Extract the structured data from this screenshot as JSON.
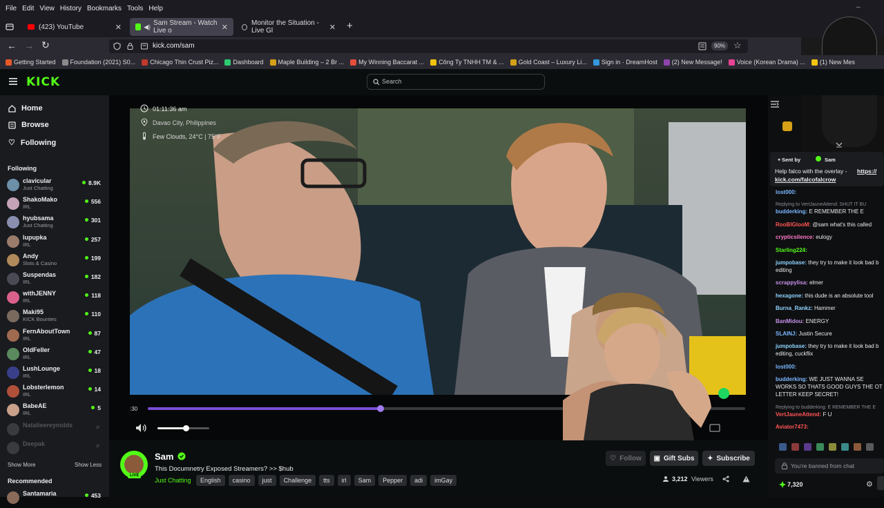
{
  "browser": {
    "menu": [
      "File",
      "Edit",
      "View",
      "History",
      "Bookmarks",
      "Tools",
      "Help"
    ],
    "tabs": [
      {
        "title": "(423) YouTube"
      },
      {
        "title": "Sam Stream - Watch Live o"
      },
      {
        "title": "Monitor the Situation - Live Gl"
      }
    ],
    "url": "kick.com/sam",
    "zoom": "90%",
    "bookmarks": [
      {
        "label": "Getting Started",
        "color": "#e8592a"
      },
      {
        "label": "Foundation (2021) S0...",
        "color": "#8a8a8a"
      },
      {
        "label": "Chicago Thin Crust Piz...",
        "color": "#c0392b"
      },
      {
        "label": "Dashboard",
        "color": "#2ecc71"
      },
      {
        "label": "Maple Building – 2 Br ...",
        "color": "#d4a017"
      },
      {
        "label": "My Winning Baccarat ...",
        "color": "#e74c3c"
      },
      {
        "label": "Công Ty TNHH TM & ...",
        "color": "#f1c40f"
      },
      {
        "label": "Gold Coast – Luxury Li...",
        "color": "#d4a017"
      },
      {
        "label": "Sign in · DreamHost",
        "color": "#3498db"
      },
      {
        "label": "(2) New Message!",
        "color": "#8e44ad"
      },
      {
        "label": "Voice (Korean Drama) ...",
        "color": "#e84393"
      },
      {
        "label": "(1) New Mes",
        "color": "#f1c40f"
      }
    ]
  },
  "kick": {
    "logo": "KICK",
    "search_placeholder": "Search",
    "nav": [
      {
        "label": "Home"
      },
      {
        "label": "Browse"
      },
      {
        "label": "Following"
      }
    ],
    "following_header": "Following",
    "following": [
      {
        "name": "clavicular",
        "category": "Just Chatting",
        "viewers": "8.9K",
        "color": "#6d8fa8"
      },
      {
        "name": "ShakoMako",
        "category": "IRL",
        "viewers": "556",
        "color": "#c4a3b8"
      },
      {
        "name": "hyubsama",
        "category": "Just Chatting",
        "viewers": "301",
        "color": "#8a8fb0"
      },
      {
        "name": "lupupka",
        "category": "IRL",
        "viewers": "257",
        "color": "#9b7b6a"
      },
      {
        "name": "Andy",
        "category": "Slots & Casino",
        "viewers": "199",
        "color": "#b08a5a"
      },
      {
        "name": "Suspendas",
        "category": "IRL",
        "viewers": "182",
        "color": "#4a4a55"
      },
      {
        "name": "withJENNY",
        "category": "IRL",
        "viewers": "118",
        "color": "#d9608a"
      },
      {
        "name": "Maki95",
        "category": "KICK Bounties",
        "viewers": "110",
        "color": "#7a6a5e"
      },
      {
        "name": "FernAboutTown",
        "category": "IRL",
        "viewers": "87",
        "color": "#a06a50"
      },
      {
        "name": "OldFeller",
        "category": "IRL",
        "viewers": "47",
        "color": "#5a8a5e"
      },
      {
        "name": "LushLounge",
        "category": "IRL",
        "viewers": "18",
        "color": "#3a3f8a"
      },
      {
        "name": "Lobsterlemon",
        "category": "IRL",
        "viewers": "14",
        "color": "#b0503a"
      },
      {
        "name": "BabeAE",
        "category": "IRL",
        "viewers": "5",
        "color": "#c9a08a"
      },
      {
        "name": "Natalieereynolds",
        "category": "",
        "viewers": "",
        "color": "#777777",
        "offline": true
      },
      {
        "name": "Deepak",
        "category": "",
        "viewers": "",
        "color": "#777777",
        "offline": true
      }
    ],
    "show_more": "Show More",
    "show_less": "Show Less",
    "recommended_header": "Recommended",
    "recommended_first": {
      "name": "Santamaria",
      "viewers": "453"
    },
    "overlay": {
      "time": "01:11:36 am",
      "location": "Davao City, Philippines",
      "weather": "Few Clouds, 24°C | 75°F"
    },
    "player": {
      "time_label": ":30",
      "progress": 0.39,
      "volume": 0.55
    },
    "stream": {
      "streamer": "Sam",
      "title": "This Documnetry Exposed Streamers? >> $hub",
      "category": "Just Chatting",
      "live_badge": "LIVE",
      "tags": [
        "English",
        "casino",
        "just",
        "Challenge",
        "tts",
        "irl",
        "Sam",
        "Pepper",
        "adi",
        "imGay"
      ],
      "viewers": "3,212",
      "viewers_label": "Viewers",
      "follow_label": "Follow",
      "gift_label": "Gift Subs",
      "subscribe_label": "Subscribe"
    },
    "chat": {
      "pinned_sent_by": "Sent by",
      "pinned_user": "Sam",
      "pinned_text": "Help falco with the overlay -",
      "pinned_link1": "https://",
      "pinned_link2": "kick.com/falcofalcrow",
      "messages": [
        {
          "user": "lost000:",
          "text": "",
          "color": "#7ab8ff",
          "reply": ""
        },
        {
          "user": "budderking:",
          "text": "E REMEMBER THE E",
          "color": "#7ab8ff",
          "reply": "Replying to VertJauneAttend: SHUT IT BU"
        },
        {
          "user": "RooBIGlooM:",
          "text": "@sam what's this called",
          "color": "#ff5555",
          "reply": ""
        },
        {
          "user": "crypticsilence:",
          "text": "eulogy",
          "color": "#ff79c6",
          "reply": ""
        },
        {
          "user": "Starling224:",
          "text": "",
          "color": "#53fc18",
          "reply": ""
        },
        {
          "user": "jumpobase:",
          "text": "they try to make it look bad b",
          "color": "#8fd3ff",
          "reply": ""
        },
        {
          "user": "",
          "text": "editing",
          "color": "#eaeaea",
          "reply": ""
        },
        {
          "user": "scrappylisa:",
          "text": "elmer",
          "color": "#c792ea",
          "reply": ""
        },
        {
          "user": "hexagone:",
          "text": "this dude is an absolute tool",
          "color": "#8fd3ff",
          "reply": ""
        },
        {
          "user": "Burna_Rankz:",
          "text": "Hammer",
          "color": "#8fd3ff",
          "reply": ""
        },
        {
          "user": "BanMidou:",
          "text": "ENERGY",
          "color": "#c792ea",
          "reply": ""
        },
        {
          "user": "SLAINJ:",
          "text": "Justin Secure",
          "color": "#7ab8ff",
          "reply": ""
        },
        {
          "user": "jumpobase:",
          "text": "they try to make it look bad b",
          "color": "#8fd3ff",
          "reply": ""
        },
        {
          "user": "",
          "text": "editing, cuckflix",
          "color": "#eaeaea",
          "reply": ""
        },
        {
          "user": "lost000:",
          "text": "",
          "color": "#7ab8ff",
          "reply": ""
        },
        {
          "user": "budderking:",
          "text": "WE JUST WANNA SE",
          "color": "#7ab8ff",
          "reply": ""
        },
        {
          "user": "",
          "text": "WORKS SO THATS GOOD GUYS THE OT",
          "color": "#eaeaea",
          "reply": ""
        },
        {
          "user": "",
          "text": "LETTER KEEP SECRET!",
          "color": "#eaeaea",
          "reply": ""
        },
        {
          "user": "VertJauneAttend:",
          "text": "F U",
          "color": "#ff5555",
          "reply": "Replying to budderking: E REMEMBER THE E"
        },
        {
          "user": "Aviator7473:",
          "text": "",
          "color": "#ff5555",
          "reply": ""
        }
      ],
      "banned_text": "You're banned from chat",
      "points": "7,320"
    }
  }
}
